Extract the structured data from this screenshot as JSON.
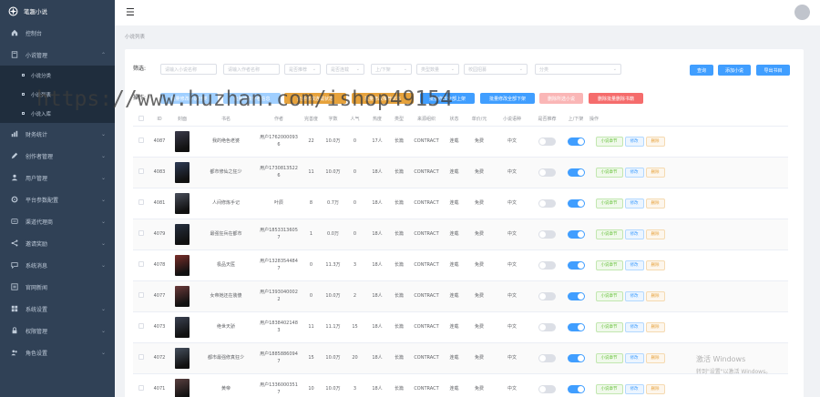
{
  "app": {
    "title": "笔趣小说"
  },
  "sidebar": {
    "items": [
      {
        "label": "控制台",
        "icon": "home-icon",
        "arrow": ""
      },
      {
        "label": "小说管理",
        "icon": "book-icon",
        "arrow": "⌃"
      }
    ],
    "sub_items": [
      "小说分类",
      "小说列表",
      "小说入库"
    ],
    "items2": [
      {
        "label": "财务统计",
        "icon": "chart-icon",
        "arrow": "⌄"
      },
      {
        "label": "创作者管理",
        "icon": "pen-icon",
        "arrow": "⌄"
      },
      {
        "label": "用户管理",
        "icon": "user-icon",
        "arrow": "⌄"
      },
      {
        "label": "平台参数配置",
        "icon": "settings-icon",
        "arrow": "⌄"
      },
      {
        "label": "渠道代理商",
        "icon": "agent-icon",
        "arrow": "⌄"
      },
      {
        "label": "邀请奖励",
        "icon": "share-icon",
        "arrow": "⌄"
      },
      {
        "label": "系统消息",
        "icon": "message-icon",
        "arrow": "⌄"
      },
      {
        "label": "官网新闻",
        "icon": "news-icon",
        "arrow": ""
      },
      {
        "label": "系统设置",
        "icon": "system-icon",
        "arrow": "⌄"
      },
      {
        "label": "权限管理",
        "icon": "lock-icon",
        "arrow": "⌄"
      },
      {
        "label": "角色设置",
        "icon": "role-icon",
        "arrow": "⌄"
      }
    ]
  },
  "breadcrumb": "小说列表",
  "filter": {
    "label": "筛选:",
    "fields": [
      "请输入小说名称",
      "请输入作者名称",
      "是否推荐",
      "是否连载",
      "上/下架",
      "类型数量",
      "校园招募",
      "分类"
    ],
    "buttons": {
      "search": "查询",
      "add": "添加小说",
      "export": "导出书目"
    }
  },
  "ops": {
    "label": "操作:",
    "buttons": [
      "批量修改小说分类",
      "批量修改作者信息",
      "批量修改连载状态",
      "批量修改推荐状态",
      "批量修改全部上架",
      "批量修改全部下架",
      "删除所选小说",
      "删除批量删除书籍"
    ]
  },
  "table": {
    "headers": [
      "",
      "ID",
      "封面",
      "书名",
      "作者",
      "完善度",
      "字数",
      "人气",
      "热度",
      "类型",
      "来源组织",
      "状态",
      "单价/元",
      "小说语种",
      "是否推荐",
      "上/下架",
      "操作"
    ],
    "row_buttons": {
      "chapter": "小说章节",
      "edit": "修改",
      "delete": "删除"
    },
    "rows": [
      {
        "id": "4087",
        "title": "我的绝色老婆",
        "author": "用户17620000936",
        "complete": "22",
        "words": "10.0万",
        "pop": "0",
        "hot": "17人",
        "type": "长篇",
        "source": "CONTRACT",
        "status": "连载",
        "price": "免费",
        "lang": "中文",
        "rec": false,
        "shelf": true
      },
      {
        "id": "4083",
        "title": "都市修仙之狂少",
        "author": "用户17308135226",
        "complete": "11",
        "words": "10.0万",
        "pop": "0",
        "hot": "18人",
        "type": "长篇",
        "source": "CONTRACT",
        "status": "连载",
        "price": "免费",
        "lang": "中文",
        "rec": false,
        "shelf": true
      },
      {
        "id": "4081",
        "title": "人间修炼手记",
        "author": "叶辰",
        "complete": "8",
        "words": "0.7万",
        "pop": "0",
        "hot": "18人",
        "type": "长篇",
        "source": "CONTRACT",
        "status": "连载",
        "price": "免费",
        "lang": "中文",
        "rec": false,
        "shelf": true
      },
      {
        "id": "4079",
        "title": "最强狂兵在都市",
        "author": "用户18533136057",
        "complete": "1",
        "words": "0.0万",
        "pop": "0",
        "hot": "18人",
        "type": "长篇",
        "source": "CONTRACT",
        "status": "连载",
        "price": "免费",
        "lang": "中文",
        "rec": false,
        "shelf": true
      },
      {
        "id": "4078",
        "title": "极品天医",
        "author": "用户13283544847",
        "complete": "0",
        "words": "11.3万",
        "pop": "3",
        "hot": "18人",
        "type": "长篇",
        "source": "CONTRACT",
        "status": "连载",
        "price": "免费",
        "lang": "中文",
        "rec": false,
        "shelf": true
      },
      {
        "id": "4077",
        "title": "女帝她还在装傻",
        "author": "用户13930400022",
        "complete": "0",
        "words": "10.0万",
        "pop": "2",
        "hot": "18人",
        "type": "长篇",
        "source": "CONTRACT",
        "status": "连载",
        "price": "免费",
        "lang": "中文",
        "rec": false,
        "shelf": true
      },
      {
        "id": "4073",
        "title": "绝世天骄",
        "author": "用户18384021483",
        "complete": "11",
        "words": "11.1万",
        "pop": "15",
        "hot": "18人",
        "type": "长篇",
        "source": "CONTRACT",
        "status": "连载",
        "price": "免费",
        "lang": "中文",
        "rec": false,
        "shelf": true
      },
      {
        "id": "4072",
        "title": "都市最强修真狂少",
        "author": "用户18858860947",
        "complete": "15",
        "words": "10.0万",
        "pop": "20",
        "hot": "18人",
        "type": "长篇",
        "source": "CONTRACT",
        "status": "连载",
        "price": "免费",
        "lang": "中文",
        "rec": false,
        "shelf": true
      },
      {
        "id": "4071",
        "title": "黄帝",
        "author": "用户13360003517",
        "complete": "10",
        "words": "10.0万",
        "pop": "3",
        "hot": "18人",
        "type": "长篇",
        "source": "CONTRACT",
        "status": "连载",
        "price": "免费",
        "lang": "中文",
        "rec": false,
        "shelf": true
      }
    ]
  },
  "watermark": {
    "url": "https://www.huzhan.com/ishop49154",
    "win1": "激活 Windows",
    "win2": "转到\"设置\"以激活 Windows。"
  },
  "colors": {
    "sidebar": "#304156",
    "primary": "#409eff",
    "warning": "#e6a23c",
    "danger": "#f56c6c",
    "success": "#67c23a"
  },
  "cover_colors": [
    "#3a3a4a",
    "#2e3b55",
    "#4a4f5c",
    "#27303f",
    "#7a2f2a",
    "#6b3a3a",
    "#3b4252",
    "#46505e",
    "#5a4040"
  ]
}
